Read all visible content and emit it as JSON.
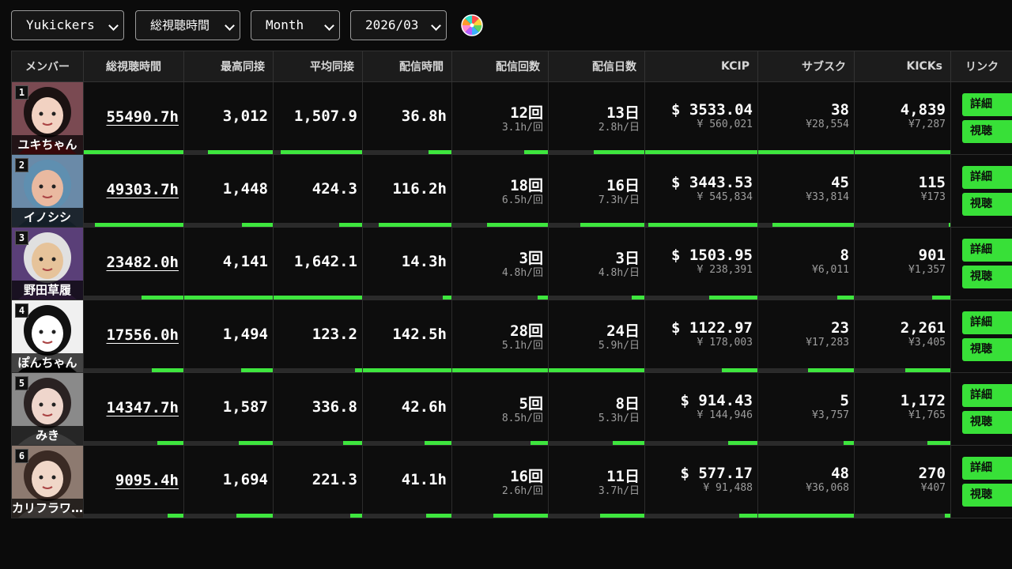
{
  "filters": {
    "group": "Yukickers",
    "metric": "総視聴時間",
    "period": "Month",
    "month": "2026/03"
  },
  "colors": {
    "accent": "#3ee63e",
    "bg": "#0b0b0b",
    "header_bg": "#1c1c1c"
  },
  "table": {
    "headers": [
      "メンバー",
      "総視聴時間",
      "最高同接",
      "平均同接",
      "配信時間",
      "配信回数",
      "配信日数",
      "KCIP",
      "サブスク",
      "KICKs",
      "リンク"
    ],
    "buttons": {
      "details": "詳細",
      "watch": "視聴"
    },
    "rows": [
      {
        "rank": "1",
        "name": "ユキちゃん",
        "total": "55490.7h",
        "peak": "3,012",
        "avg": "1,507.9",
        "time": "36.8h",
        "streams": "12回",
        "per_stream": "3.1h/回",
        "days": "13日",
        "per_day": "2.8h/日",
        "kcip": "$ 3533.04",
        "kcip_yen": "¥ 560,021",
        "subs": "38",
        "subs_yen": "¥28,554",
        "kicks": "4,839",
        "kicks_yen": "¥7,287"
      },
      {
        "rank": "2",
        "name": "イノシシ",
        "total": "49303.7h",
        "peak": "1,448",
        "avg": "424.3",
        "time": "116.2h",
        "streams": "18回",
        "per_stream": "6.5h/回",
        "days": "16日",
        "per_day": "7.3h/日",
        "kcip": "$ 3443.53",
        "kcip_yen": "¥ 545,834",
        "subs": "45",
        "subs_yen": "¥33,814",
        "kicks": "115",
        "kicks_yen": "¥173"
      },
      {
        "rank": "3",
        "name": "野田草履",
        "total": "23482.0h",
        "peak": "4,141",
        "avg": "1,642.1",
        "time": "14.3h",
        "streams": "3回",
        "per_stream": "4.8h/回",
        "days": "3日",
        "per_day": "4.8h/日",
        "kcip": "$ 1503.95",
        "kcip_yen": "¥ 238,391",
        "subs": "8",
        "subs_yen": "¥6,011",
        "kicks": "901",
        "kicks_yen": "¥1,357"
      },
      {
        "rank": "4",
        "name": "ぽんちゃん",
        "total": "17556.0h",
        "peak": "1,494",
        "avg": "123.2",
        "time": "142.5h",
        "streams": "28回",
        "per_stream": "5.1h/回",
        "days": "24日",
        "per_day": "5.9h/日",
        "kcip": "$ 1122.97",
        "kcip_yen": "¥ 178,003",
        "subs": "23",
        "subs_yen": "¥17,283",
        "kicks": "2,261",
        "kicks_yen": "¥3,405"
      },
      {
        "rank": "5",
        "name": "みき",
        "total": "14347.7h",
        "peak": "1,587",
        "avg": "336.8",
        "time": "42.6h",
        "streams": "5回",
        "per_stream": "8.5h/回",
        "days": "8日",
        "per_day": "5.3h/日",
        "kcip": "$ 914.43",
        "kcip_yen": "¥ 144,946",
        "subs": "5",
        "subs_yen": "¥3,757",
        "kicks": "1,172",
        "kicks_yen": "¥1,765"
      },
      {
        "rank": "6",
        "name": "カリフラワ…",
        "total": "9095.4h",
        "peak": "1,694",
        "avg": "221.3",
        "time": "41.1h",
        "streams": "16回",
        "per_stream": "2.6h/回",
        "days": "11日",
        "per_day": "3.7h/日",
        "kcip": "$ 577.17",
        "kcip_yen": "¥ 91,488",
        "subs": "48",
        "subs_yen": "¥36,068",
        "kicks": "270",
        "kicks_yen": "¥407"
      }
    ]
  }
}
